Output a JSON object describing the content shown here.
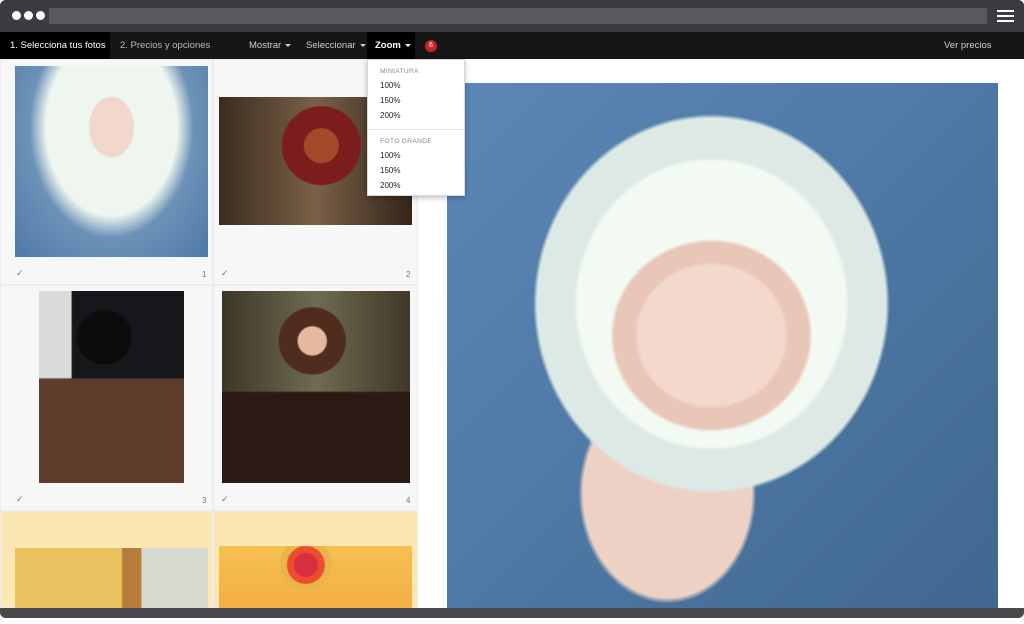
{
  "window": {
    "titlebar": {
      "dots_icon": "window-dots-icon",
      "menu_icon": "hamburger-menu-icon"
    }
  },
  "nav": {
    "steps": [
      {
        "label": "1. Selecciona tus fotos"
      },
      {
        "label": "2. Precios y opciones"
      }
    ],
    "menus": [
      {
        "label": "Mostrar"
      },
      {
        "label": "Seleccionar"
      },
      {
        "label": "Zoom"
      }
    ],
    "badge_count": "6",
    "ver_precios": "Ver precios",
    "colors": {
      "navbar": "#161616",
      "active": "#000000",
      "badge": "#c7252c"
    }
  },
  "zoom_dropdown": {
    "sections": [
      {
        "heading": "MINIATURA",
        "items": [
          "100%",
          "150%",
          "200%"
        ]
      },
      {
        "heading": "FOTO GRANDE",
        "items": [
          "100%",
          "150%",
          "200%"
        ]
      }
    ]
  },
  "gallery": {
    "items": [
      {
        "number": "1",
        "check": "✓"
      },
      {
        "number": "2",
        "check": "✓"
      },
      {
        "number": "3",
        "check": "✓"
      },
      {
        "number": "4",
        "check": "✓"
      },
      {
        "number": "",
        "check": ""
      },
      {
        "number": "",
        "check": ""
      }
    ]
  }
}
